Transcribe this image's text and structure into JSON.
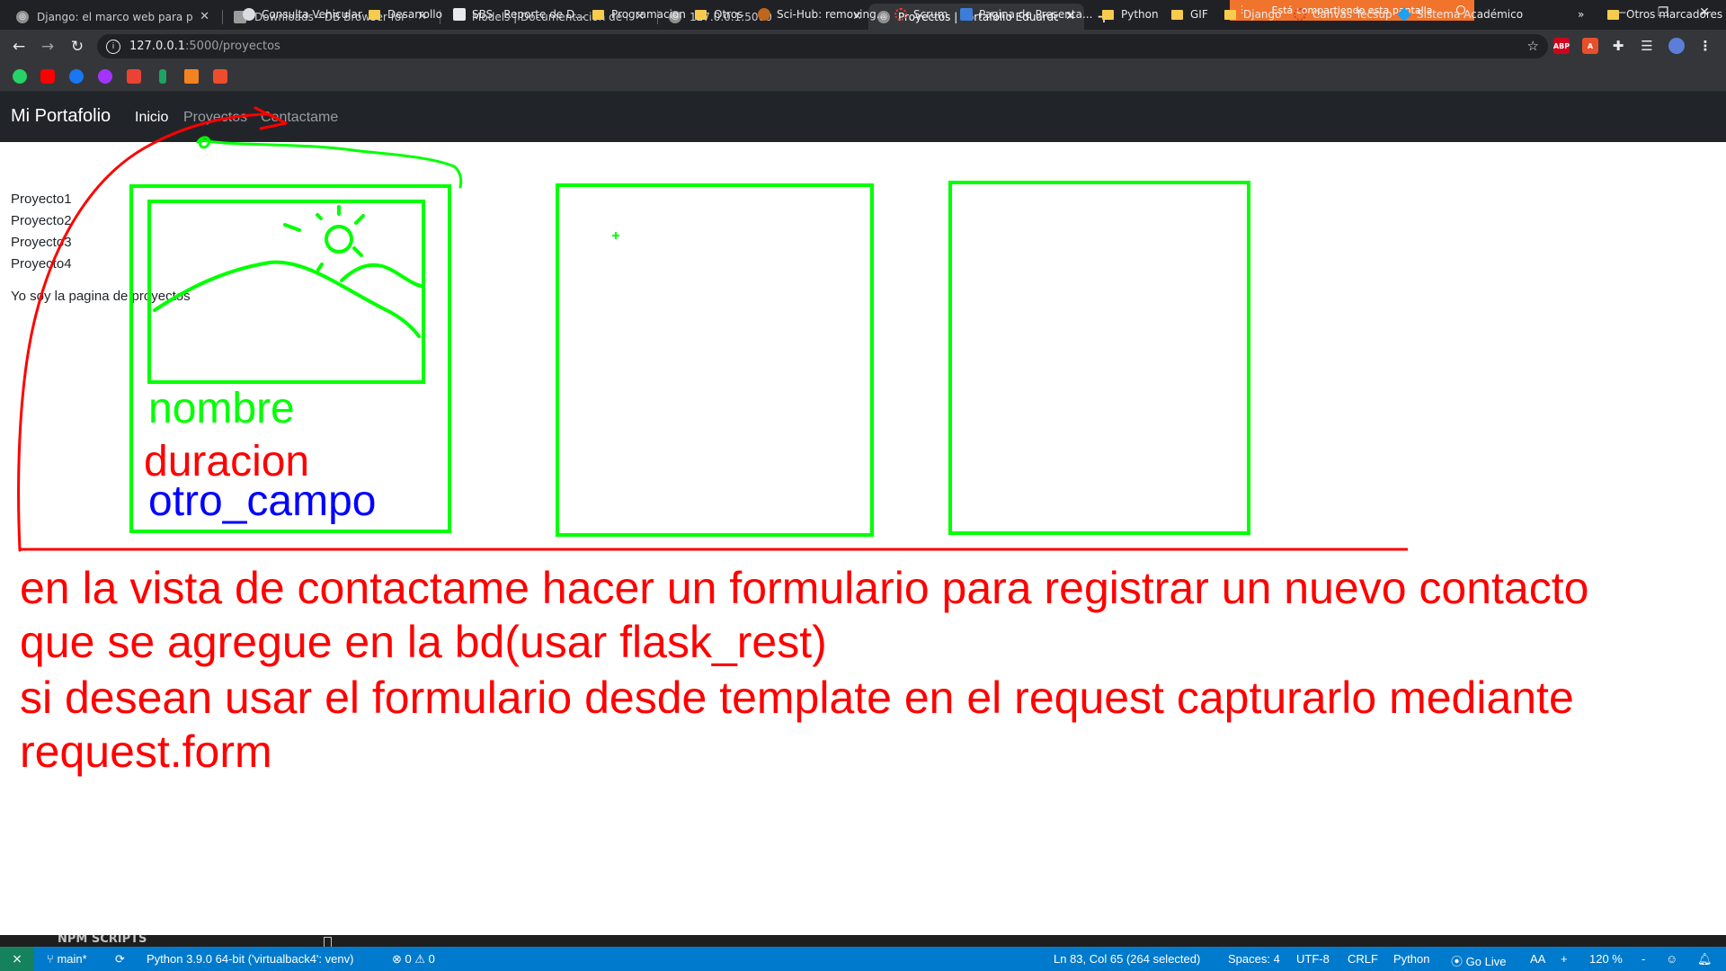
{
  "browser": {
    "tabs": [
      {
        "title": "Django: el marco web para perfe",
        "icon": "globe-icon"
      },
      {
        "title": "Downloads - DB Browser for SQL",
        "icon": "database-icon"
      },
      {
        "title": "Models | Documentación de Djan",
        "icon": "django-icon",
        "favicon_text": "dj"
      },
      {
        "title": "127.0.0.1:5000",
        "icon": "globe-icon"
      },
      {
        "title": "Proyectos | Portafolio Eduardo",
        "icon": "globe-icon",
        "active": true
      }
    ],
    "sharing_banner": "Está compartiendo esta pantalla",
    "url": {
      "host": "127.0.0.1",
      "path": ":5000/proyectos"
    },
    "bookmarks": [
      {
        "label": "Consulta Vehicular",
        "icon": "globe-icon"
      },
      {
        "label": "Desarrollo",
        "icon": "folder-icon"
      },
      {
        "label": "SBS - Reporte de D...",
        "icon": "sbs-icon"
      },
      {
        "label": "Programacion",
        "icon": "folder-icon"
      },
      {
        "label": "Otros",
        "icon": "folder-icon"
      },
      {
        "label": "Sci-Hub: removing...",
        "icon": "scihub-icon"
      },
      {
        "label": "Scrum",
        "icon": "scrum-icon"
      },
      {
        "label": "Pagina de Presenta...",
        "icon": "hash-icon"
      },
      {
        "label": "Python",
        "icon": "folder-icon"
      },
      {
        "label": "GIF",
        "icon": "folder-icon"
      },
      {
        "label": "Django",
        "icon": "folder-icon"
      },
      {
        "label": "Canvas Tecsup",
        "icon": "canvas-icon"
      },
      {
        "label": "Sistema Académico",
        "icon": "academic-icon"
      }
    ],
    "bookmarks_overflow": "»",
    "other_bookmarks": "Otros marcadores",
    "extensions": [
      {
        "name": "adblock-icon",
        "text": "ABP",
        "color": "#d0021b"
      },
      {
        "name": "pdf-icon",
        "text": "A",
        "color": "#e94f2a"
      }
    ]
  },
  "site": {
    "brand": "Mi Portafolio",
    "nav": [
      {
        "label": "Inicio",
        "active": true
      },
      {
        "label": "Proyectos",
        "active": false
      },
      {
        "label": "Contactame",
        "active": false
      }
    ],
    "projects": [
      "Proyecto1",
      "Proyecto2",
      "Proyecto3",
      "Proyecto4"
    ],
    "page_text": "Yo soy la pagina de proyectos"
  },
  "annotations": {
    "card_fields": {
      "name": "nombre",
      "duration": "duracion",
      "other": "otro_campo"
    },
    "note_lines": [
      "en la vista de contactame hacer un formulario para registrar un nuevo contacto",
      "que se agregue en la bd(usar flask_rest)",
      "si desean usar el formulario desde template en el request capturarlo mediante",
      "request.form"
    ],
    "colors": {
      "green": "#00ff00",
      "red": "#ff0000",
      "blue": "#0000ff"
    }
  },
  "vscode": {
    "section_label": "NPM SCRIPTS",
    "status": {
      "branch": "main*",
      "interpreter": "Python 3.9.0 64-bit ('virtualback4': venv)",
      "errors": "0",
      "warnings": "0",
      "cursor": "Ln 83, Col 65 (264 selected)",
      "spaces": "Spaces: 4",
      "encoding": "UTF-8",
      "eol": "CRLF",
      "language": "Python",
      "golive": "Go Live",
      "zoom": "120 %"
    }
  }
}
